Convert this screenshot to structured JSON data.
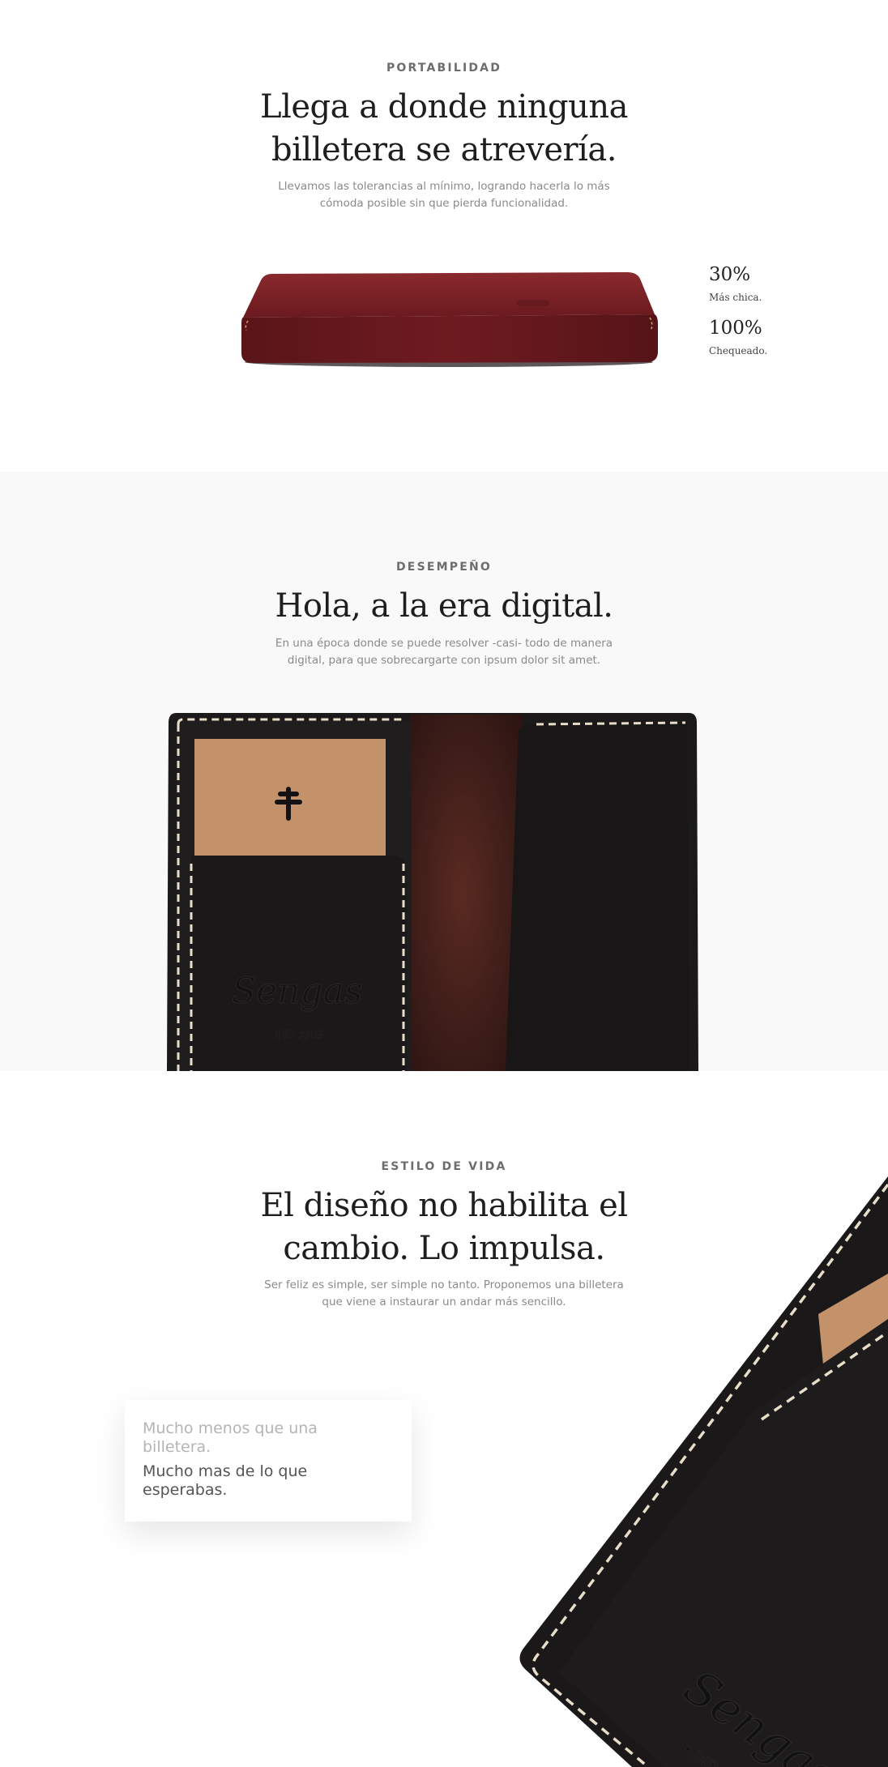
{
  "portabilidad": {
    "eyebrow": "PORTABILIDAD",
    "heading_line1": "Llega a donde ninguna",
    "heading_line2": "billetera se atrevería.",
    "lead_line1": "Llevamos las tolerancias al mínimo, logrando hacerla lo más",
    "lead_line2": "cómoda posible sin que pierda funcionalidad.",
    "image": "wallet-side-view",
    "stats": [
      {
        "value": "30%",
        "label": "Más chica."
      },
      {
        "value": "100%",
        "label": "Chequeado."
      }
    ]
  },
  "desempeno": {
    "eyebrow": "DESEMPEÑO",
    "heading": "Hola, a la era digital.",
    "lead_line1": "En una época donde se puede resolver -casi- todo de manera",
    "lead_line2": "digital, para que sobrecargarte con ipsum dolor sit amet.",
    "image": "wallet-open-view"
  },
  "estilo": {
    "eyebrow": "ESTILO DE VIDA",
    "heading_line1": "El diseño no habilita el",
    "heading_line2": "cambio. Lo impulsa.",
    "lead_line1": "Ser feliz es simple, ser simple no tanto. Proponemos una billetera",
    "lead_line2": "que viene a instaurar un andar más sencillo.",
    "card": {
      "muted_line1": "Mucho menos que una",
      "muted_line2": "billetera.",
      "main_line1": "Mucho mas de lo que",
      "main_line2": "esperabas."
    },
    "image": "wallet-angled-view"
  },
  "colors": {
    "wallet_red": "#6b1a1f",
    "wallet_black": "#1a1818",
    "card_tan": "#c4926a",
    "stitch": "#e8ddc8"
  }
}
